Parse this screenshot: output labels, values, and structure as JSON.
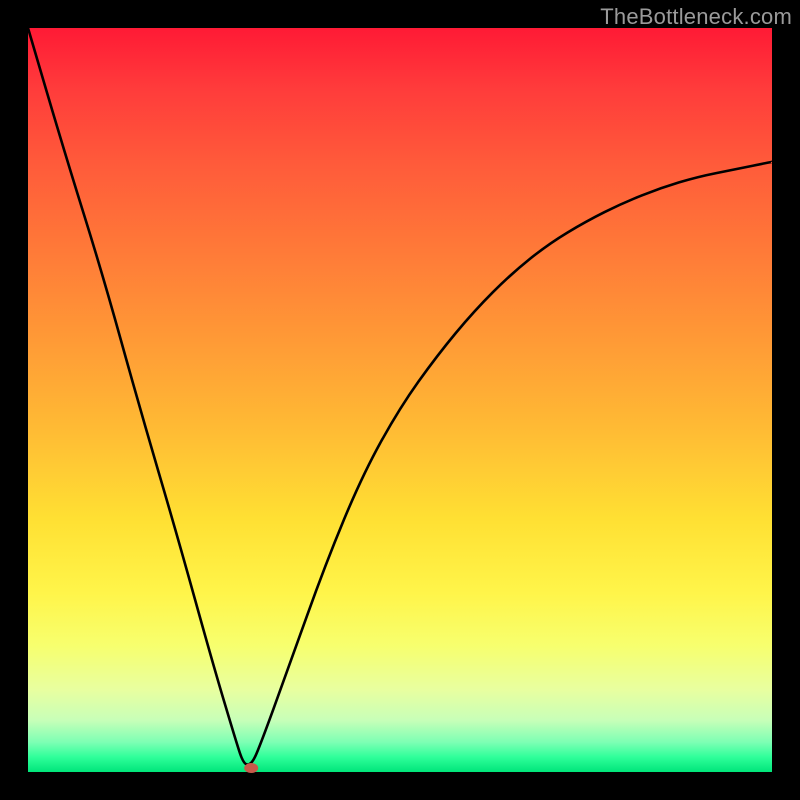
{
  "watermark": "TheBottleneck.com",
  "chart_data": {
    "type": "line",
    "title": "",
    "xlabel": "",
    "ylabel": "",
    "xlim": [
      0,
      100
    ],
    "ylim": [
      0,
      100
    ],
    "grid": false,
    "background": "red-yellow-green vertical gradient",
    "series": [
      {
        "name": "curve",
        "x": [
          0,
          5,
          10,
          15,
          20,
          25,
          28,
          29,
          30,
          31,
          35,
          40,
          45,
          50,
          55,
          60,
          65,
          70,
          75,
          80,
          85,
          90,
          95,
          100
        ],
        "y": [
          100,
          83,
          67,
          49,
          32,
          14,
          4,
          1,
          1,
          3,
          14,
          28,
          40,
          49,
          56,
          62,
          67,
          71,
          74,
          76.5,
          78.5,
          80,
          81,
          82
        ]
      }
    ],
    "min_marker": {
      "x": 30,
      "y": 0
    }
  },
  "colors": {
    "curve": "#000000",
    "marker": "#c75a4a",
    "frame": "#000000"
  }
}
